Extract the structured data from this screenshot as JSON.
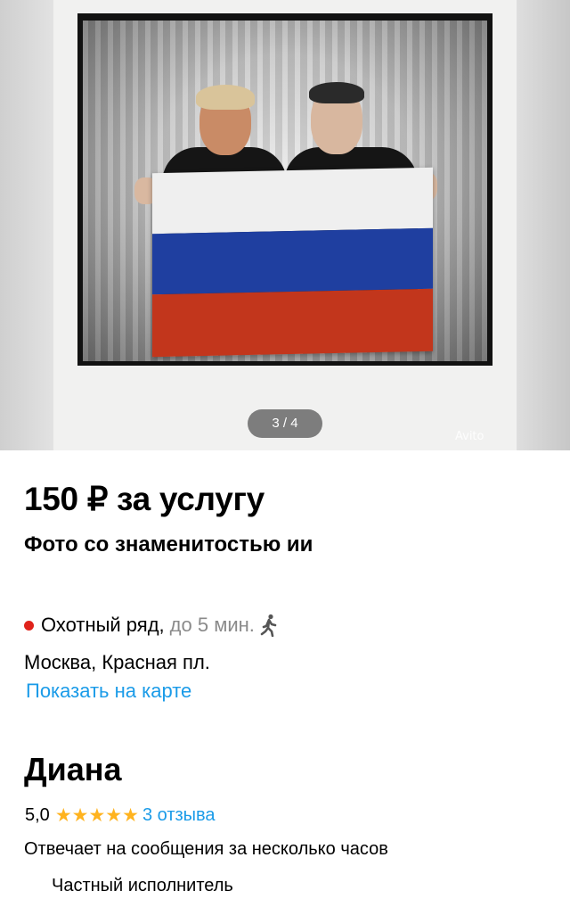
{
  "gallery": {
    "counter": "3 / 4",
    "watermark": "Avito"
  },
  "listing": {
    "price": "150 ₽ за услугу",
    "title": "Фото со знаменитостью ии"
  },
  "location": {
    "metro": "Охотный ряд,",
    "metro_time": "до 5 мин.",
    "metro_color": "#e0231b",
    "address": "Москва, Красная пл.",
    "map_link": "Показать на карте"
  },
  "seller": {
    "name": "Диана",
    "rating": "5,0",
    "stars": "★★★★★",
    "reviews": "3 отзыва",
    "response_time": "Отвечает на сообщения за несколько часов",
    "type": "Частный исполнитель"
  },
  "colors": {
    "link": "#1a9be8",
    "star": "#ffb31f"
  }
}
